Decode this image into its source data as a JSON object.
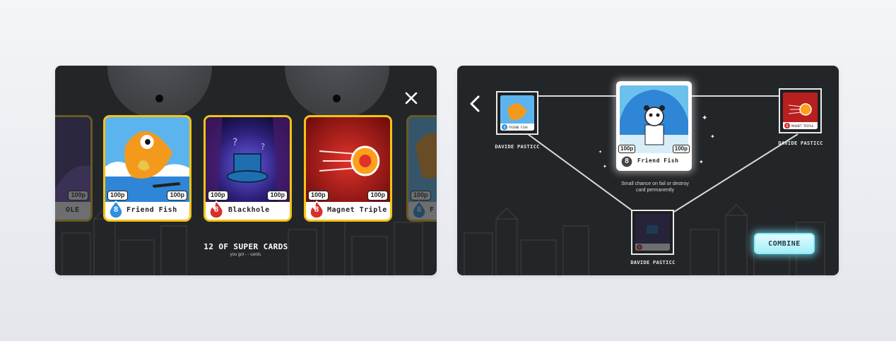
{
  "left_panel": {
    "cards": [
      {
        "name": "Friend Fish",
        "price_left": "100p",
        "price_right": "100p",
        "badge": "8",
        "badge_color": "#2f8fe0"
      },
      {
        "name": "Blackhole",
        "price_left": "100p",
        "price_right": "100p",
        "badge": "8",
        "badge_color": "#d6312b"
      },
      {
        "name": "Magnet Triple",
        "price_left": "100p",
        "price_right": "100p",
        "badge": "8",
        "badge_color": "#d6312b"
      }
    ],
    "ghost_left": {
      "name": "OLE",
      "price": "100p",
      "badge": "8"
    },
    "ghost_right": {
      "name": "F",
      "price_left": "100p",
      "badge": "8"
    },
    "title": "12 OF SUPER CARDS",
    "subtitle": "you got - - cards.",
    "close_icon": "close-icon"
  },
  "right_panel": {
    "center_card": {
      "name": "Friend Fish",
      "price_left": "100p",
      "price_right": "100p",
      "badge": "8"
    },
    "mini_left_card": {
      "name": "FRIEND FISH",
      "badge": "8"
    },
    "mini_right_card": {
      "name": "MAGNET TRIPLE",
      "badge": "8"
    },
    "mini_bottom_card": {
      "badge": "8"
    },
    "player_left": "DAVIDE PASTICC",
    "player_right": "DAVIDE PASTICC",
    "player_bottom": "DAVIDE PASTICC",
    "warning_line1": "Small chance on fail or destroy",
    "warning_line2": "card permanently",
    "combine_label": "COMBINE",
    "back_icon": "chevron-left-icon"
  },
  "colors": {
    "card_border": "#f4c313",
    "panel_bg": "#232629",
    "combine_glow": "#7df0ff",
    "badge_blue": "#2f8fe0",
    "badge_red": "#d6312b"
  }
}
